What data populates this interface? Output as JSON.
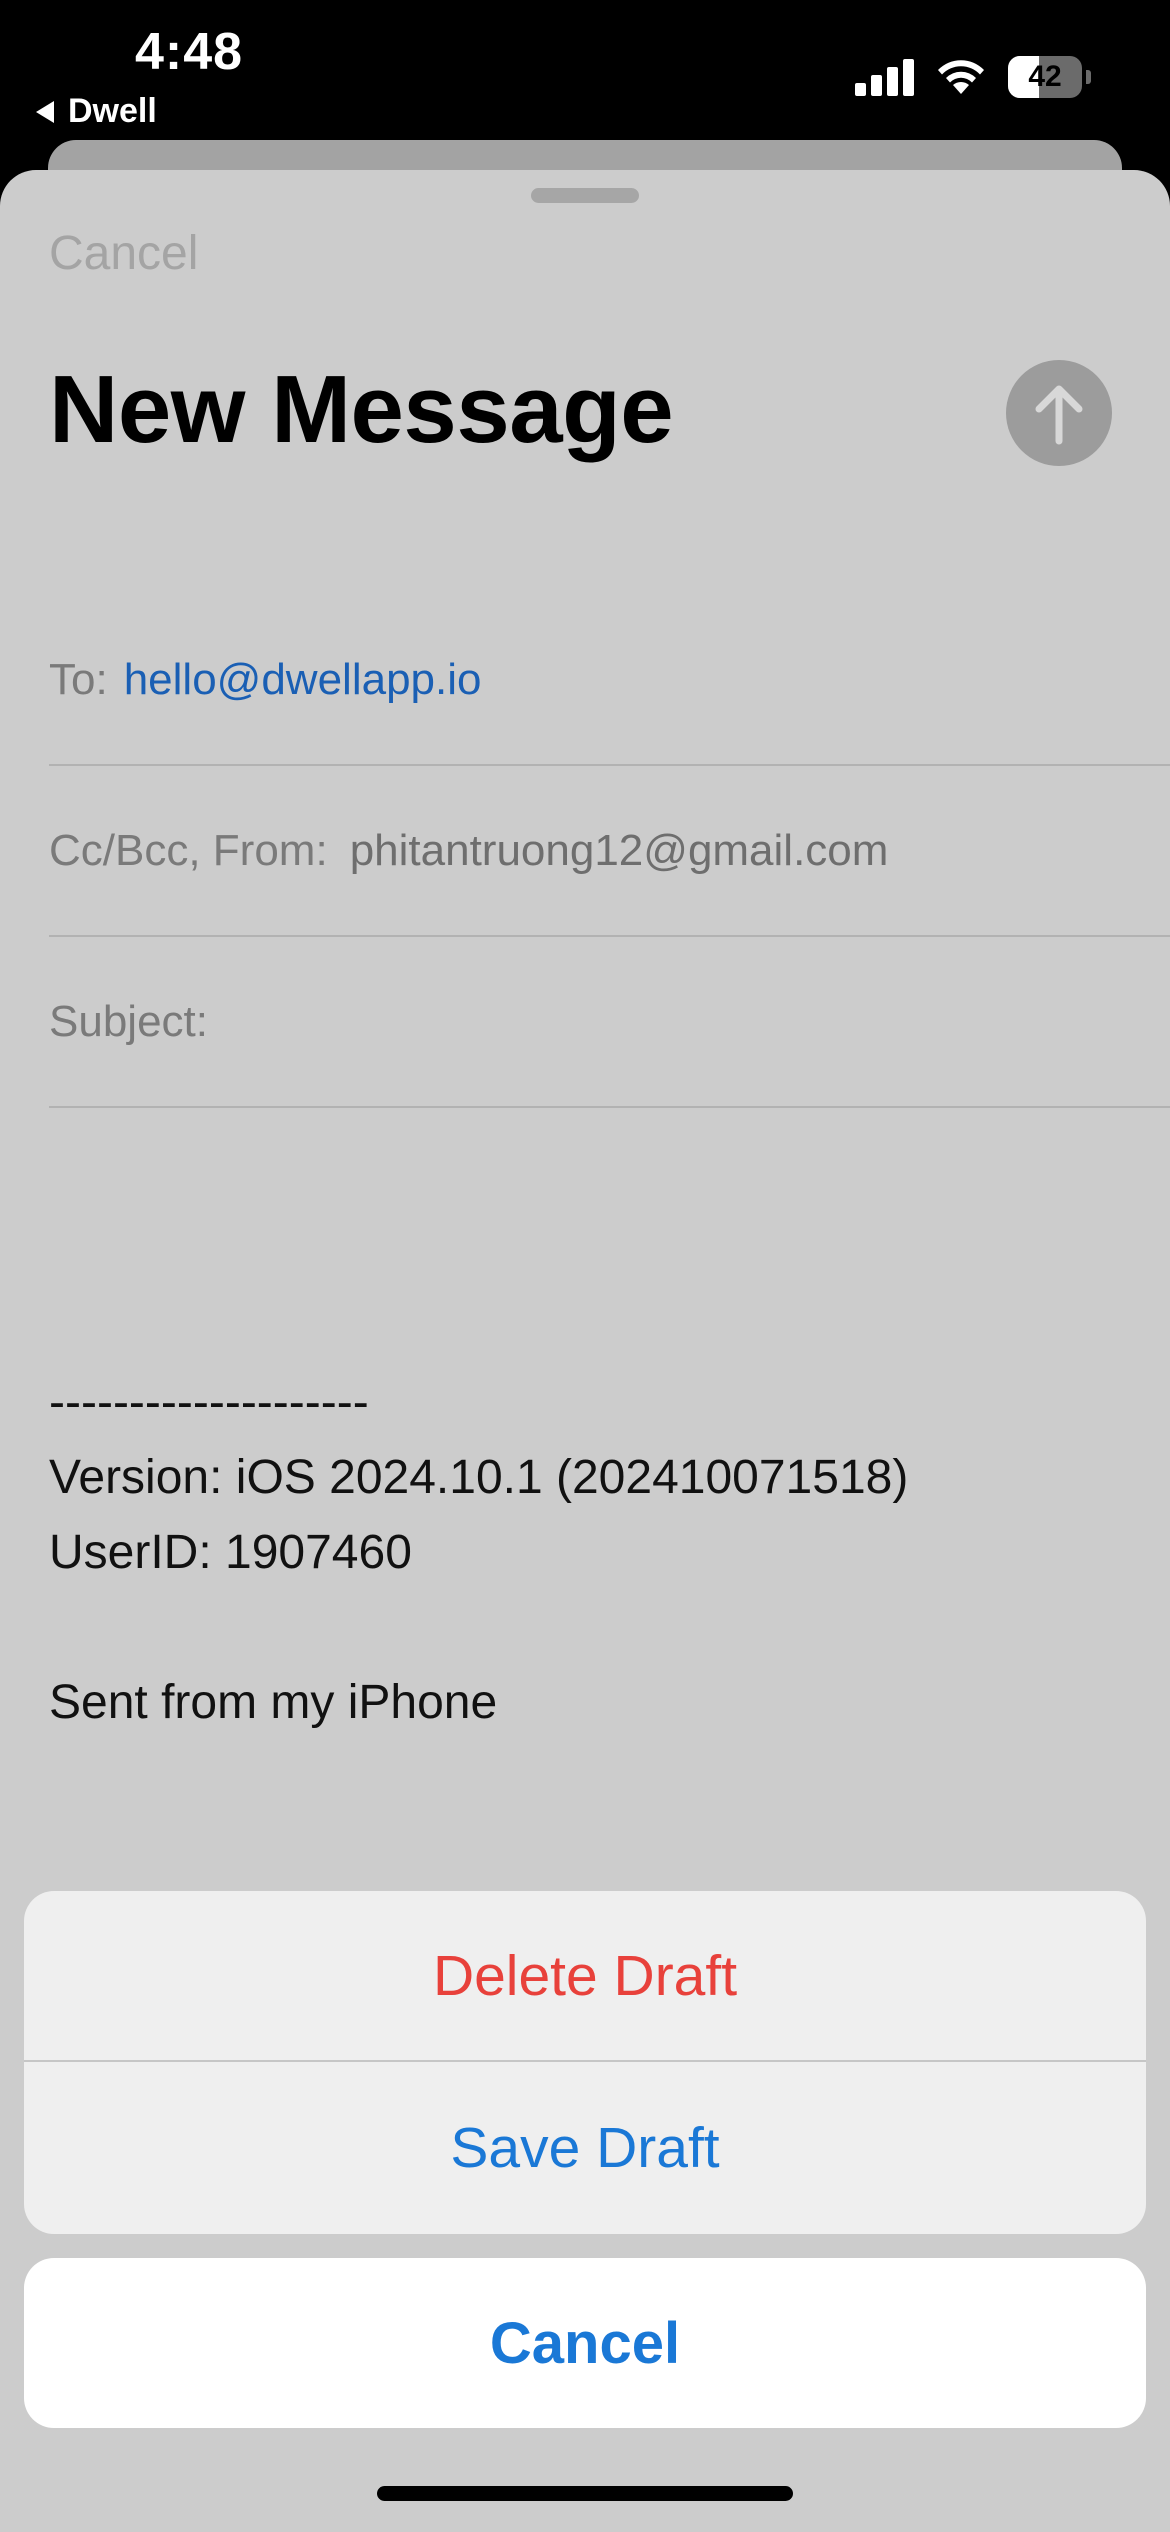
{
  "status_bar": {
    "time": "4:48",
    "back_app": "Dwell",
    "battery_level": "42"
  },
  "compose": {
    "cancel_label": "Cancel",
    "title": "New Message",
    "to_label": "To:",
    "to_value": "hello@dwellapp.io",
    "cc_from_label": "Cc/Bcc, From:",
    "from_value": "phitantruong12@gmail.com",
    "subject_label": "Subject:",
    "body_lines": [
      "--------------------",
      "Version: iOS 2024.10.1 (202410071518)",
      "UserID: 1907460",
      "",
      "Sent from my iPhone"
    ]
  },
  "action_sheet": {
    "delete_label": "Delete Draft",
    "save_label": "Save Draft",
    "cancel_label": "Cancel"
  },
  "colors": {
    "link_blue": "#1a78d6",
    "destructive_red": "#e8413b"
  }
}
